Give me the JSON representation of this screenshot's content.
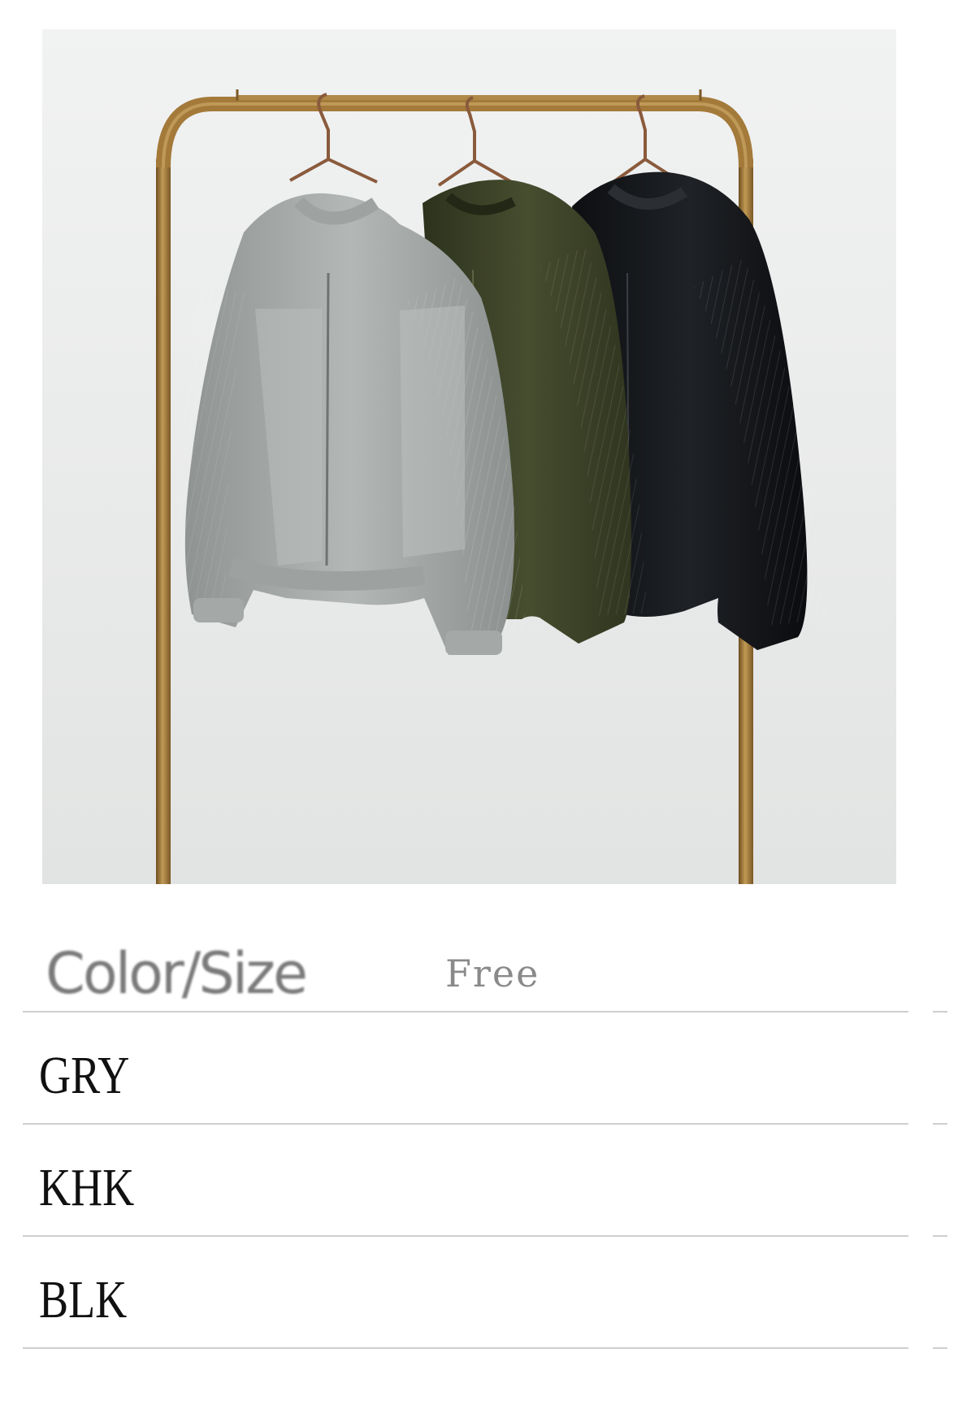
{
  "product_photo": {
    "alt_subject": "three jackets on a clothing rack",
    "colors": {
      "wall": "#eceeed",
      "rack": "#a47a3a",
      "gray_jacket": "#a9adab",
      "khaki_jacket": "#3f4429",
      "black_jacket": "#15171a"
    }
  },
  "size_table": {
    "header": {
      "label": "Color/Size",
      "size": "Free"
    },
    "rows": [
      {
        "color": "GRY"
      },
      {
        "color": "KHK"
      },
      {
        "color": "BLK"
      }
    ]
  }
}
